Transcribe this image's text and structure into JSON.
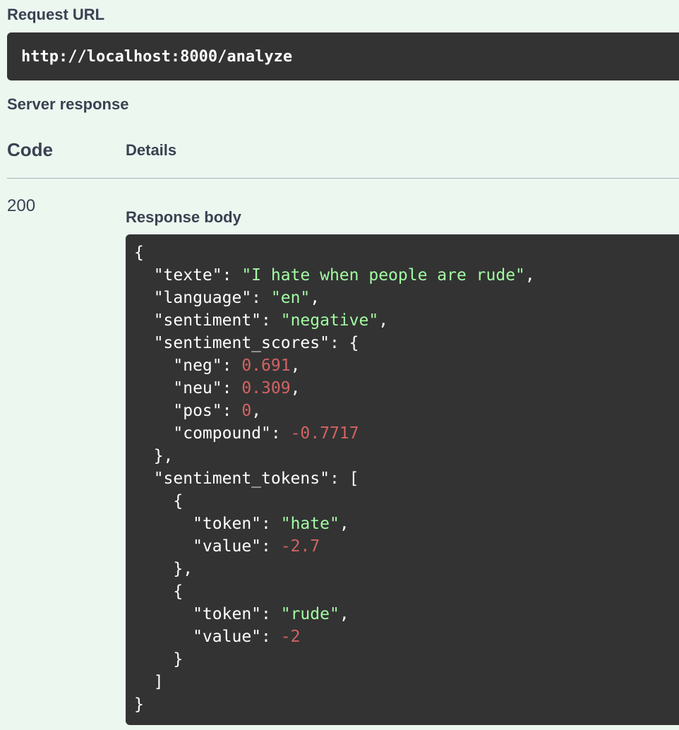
{
  "request_url": {
    "label": "Request URL",
    "url": "http://localhost:8000/analyze"
  },
  "server_response": {
    "label": "Server response",
    "columns": {
      "code": "Code",
      "details": "Details"
    },
    "status_code": "200",
    "response_body_label": "Response body",
    "colors": {
      "background": "#ecf7f0",
      "code_bg": "#333333",
      "string": "#a2fca2",
      "number": "#d36363",
      "text": "#ffffff"
    },
    "body_lines": [
      [
        {
          "t": "p",
          "v": "{"
        }
      ],
      [
        {
          "t": "p",
          "v": "  \"texte\": "
        },
        {
          "t": "s",
          "v": "\"I hate when people are rude\""
        },
        {
          "t": "p",
          "v": ","
        }
      ],
      [
        {
          "t": "p",
          "v": "  \"language\": "
        },
        {
          "t": "s",
          "v": "\"en\""
        },
        {
          "t": "p",
          "v": ","
        }
      ],
      [
        {
          "t": "p",
          "v": "  \"sentiment\": "
        },
        {
          "t": "s",
          "v": "\"negative\""
        },
        {
          "t": "p",
          "v": ","
        }
      ],
      [
        {
          "t": "p",
          "v": "  \"sentiment_scores\": {"
        }
      ],
      [
        {
          "t": "p",
          "v": "    \"neg\": "
        },
        {
          "t": "n",
          "v": "0.691"
        },
        {
          "t": "p",
          "v": ","
        }
      ],
      [
        {
          "t": "p",
          "v": "    \"neu\": "
        },
        {
          "t": "n",
          "v": "0.309"
        },
        {
          "t": "p",
          "v": ","
        }
      ],
      [
        {
          "t": "p",
          "v": "    \"pos\": "
        },
        {
          "t": "n",
          "v": "0"
        },
        {
          "t": "p",
          "v": ","
        }
      ],
      [
        {
          "t": "p",
          "v": "    \"compound\": "
        },
        {
          "t": "n",
          "v": "-0.7717"
        }
      ],
      [
        {
          "t": "p",
          "v": "  },"
        }
      ],
      [
        {
          "t": "p",
          "v": "  \"sentiment_tokens\": ["
        }
      ],
      [
        {
          "t": "p",
          "v": "    {"
        }
      ],
      [
        {
          "t": "p",
          "v": "      \"token\": "
        },
        {
          "t": "s",
          "v": "\"hate\""
        },
        {
          "t": "p",
          "v": ","
        }
      ],
      [
        {
          "t": "p",
          "v": "      \"value\": "
        },
        {
          "t": "n",
          "v": "-2.7"
        }
      ],
      [
        {
          "t": "p",
          "v": "    },"
        }
      ],
      [
        {
          "t": "p",
          "v": "    {"
        }
      ],
      [
        {
          "t": "p",
          "v": "      \"token\": "
        },
        {
          "t": "s",
          "v": "\"rude\""
        },
        {
          "t": "p",
          "v": ","
        }
      ],
      [
        {
          "t": "p",
          "v": "      \"value\": "
        },
        {
          "t": "n",
          "v": "-2"
        }
      ],
      [
        {
          "t": "p",
          "v": "    }"
        }
      ],
      [
        {
          "t": "p",
          "v": "  ]"
        }
      ],
      [
        {
          "t": "p",
          "v": "}"
        }
      ]
    ]
  }
}
